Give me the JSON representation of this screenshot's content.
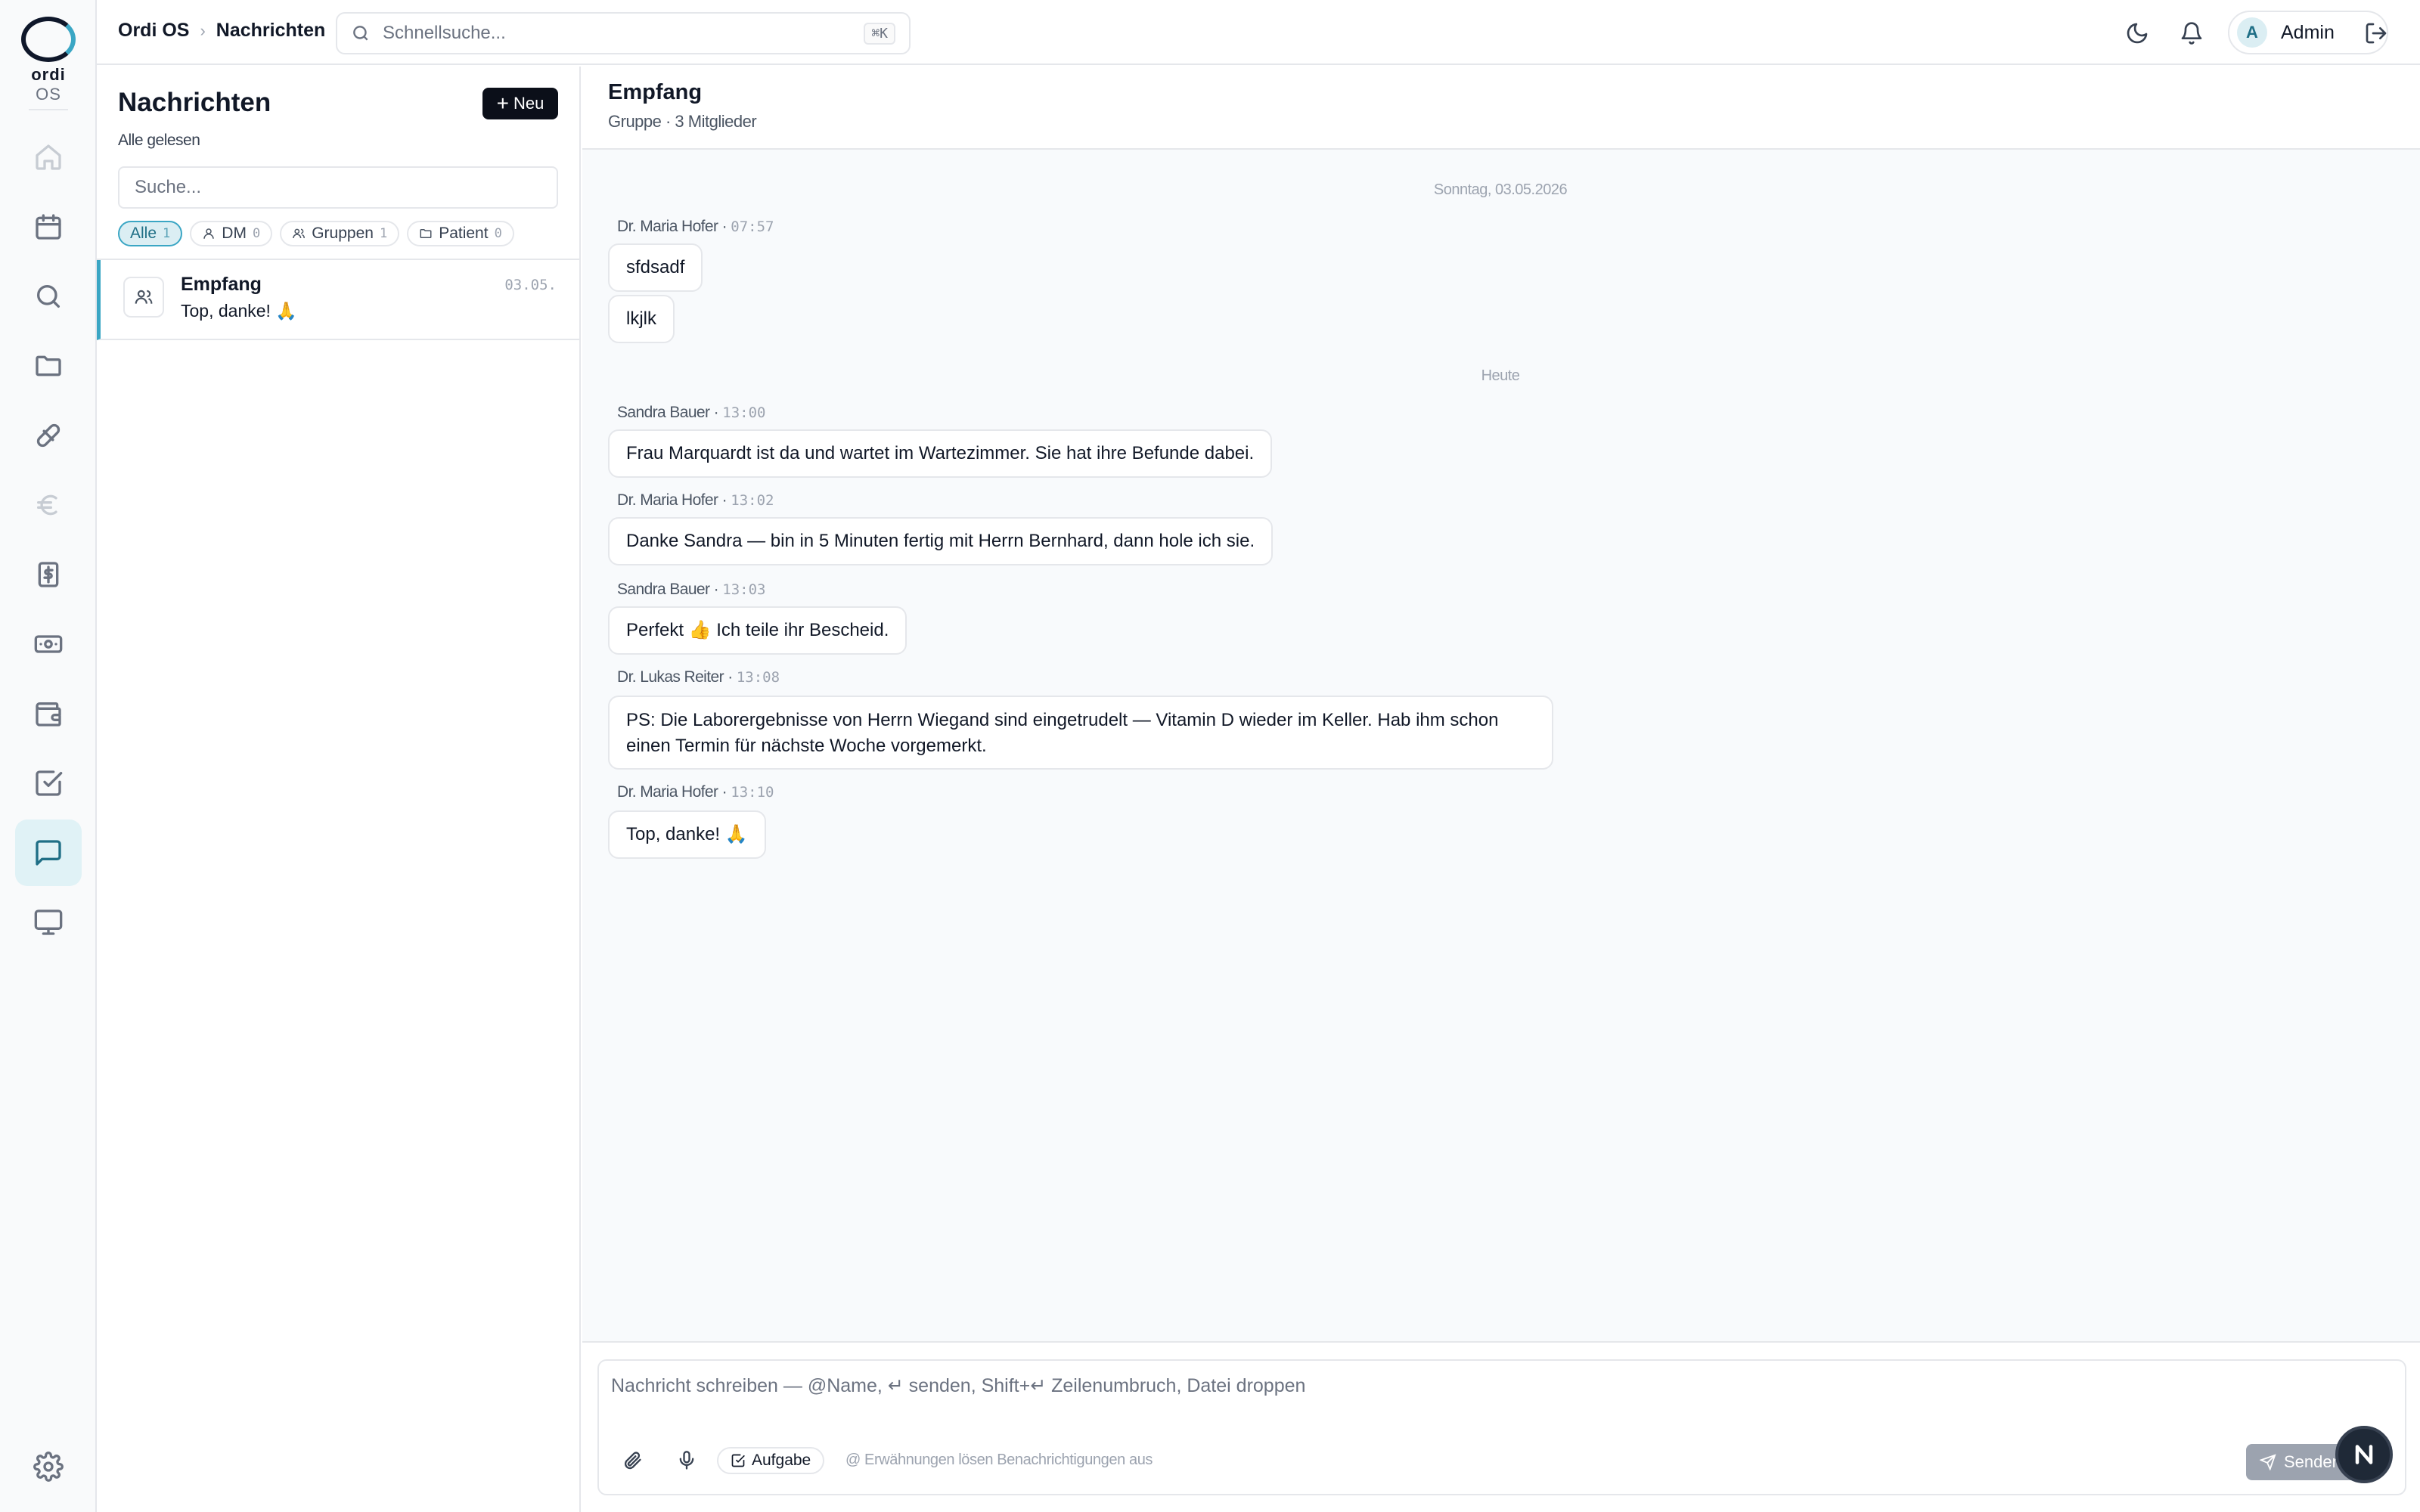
{
  "app": {
    "brand_primary": "ordi",
    "brand_secondary": "OS"
  },
  "breadcrumb": {
    "root": "Ordi OS",
    "current": "Nachrichten"
  },
  "search": {
    "placeholder": "Schnellsuche...",
    "shortcut": "⌘K"
  },
  "user": {
    "initial": "A",
    "name": "Admin"
  },
  "sidebar": {
    "items": [
      {
        "icon": "home-icon",
        "state": "disabled"
      },
      {
        "icon": "calendar-icon",
        "state": "normal"
      },
      {
        "icon": "search-icon",
        "state": "normal"
      },
      {
        "icon": "folder-icon",
        "state": "normal"
      },
      {
        "icon": "pill-icon",
        "state": "normal"
      },
      {
        "icon": "euro-icon",
        "state": "disabled"
      },
      {
        "icon": "dollar-receipt-icon",
        "state": "normal"
      },
      {
        "icon": "banknote-icon",
        "state": "normal"
      },
      {
        "icon": "wallet-icon",
        "state": "normal"
      },
      {
        "icon": "checkbox-icon",
        "state": "normal"
      },
      {
        "icon": "chat-icon",
        "state": "active"
      },
      {
        "icon": "monitor-icon",
        "state": "normal"
      },
      {
        "icon": "gear-icon",
        "state": "normal"
      }
    ]
  },
  "conversations": {
    "title": "Nachrichten",
    "new_label": "Neu",
    "mark_all_read": "Alle gelesen",
    "search_placeholder": "Suche...",
    "filters": [
      {
        "label": "Alle",
        "count": "1",
        "active": true
      },
      {
        "label": "DM",
        "count": "0",
        "icon": "user-icon"
      },
      {
        "label": "Gruppen",
        "count": "1",
        "icon": "users-icon"
      },
      {
        "label": "Patient",
        "count": "0",
        "icon": "folder-icon"
      }
    ],
    "items": [
      {
        "name": "Empfang",
        "preview": "Top, danke! 🙏",
        "date": "03.05.",
        "icon": "users-icon"
      }
    ]
  },
  "chat": {
    "title": "Empfang",
    "subtitle": "Gruppe · 3 Mitglieder",
    "day_separators": [
      "Sonntag, 03.05.2026",
      "Heute"
    ],
    "messages": [
      {
        "sender": "Dr. Maria Hofer",
        "time": "07:57",
        "texts": [
          "sfdsadf",
          "lkjlk"
        ]
      },
      {
        "sender": "Sandra Bauer",
        "time": "13:00",
        "texts": [
          "Frau Marquardt ist da und wartet im Wartezimmer. Sie hat ihre Befunde dabei."
        ]
      },
      {
        "sender": "Dr. Maria Hofer",
        "time": "13:02",
        "texts": [
          "Danke Sandra — bin in 5 Minuten fertig mit Herrn Bernhard, dann hole ich sie."
        ]
      },
      {
        "sender": "Sandra Bauer",
        "time": "13:03",
        "texts": [
          "Perfekt 👍 Ich teile ihr Bescheid."
        ]
      },
      {
        "sender": "Dr. Lukas Reiter",
        "time": "13:08",
        "texts": [
          "PS: Die Laborergebnisse von Herrn Wiegand sind eingetrudelt — Vitamin D wieder im Keller. Hab ihm schon einen Termin für nächste Woche vorgemerkt."
        ]
      },
      {
        "sender": "Dr. Maria Hofer",
        "time": "13:10",
        "texts": [
          "Top, danke! 🙏"
        ]
      }
    ]
  },
  "composer": {
    "placeholder": "Nachricht schreiben — @Name, ↵ senden, Shift+↵ Zeilenumbruch, Datei droppen",
    "task_label": "Aufgabe",
    "mention_hint": "@ Erwähnungen lösen Benachrichtigungen aus",
    "send_label": "Senden"
  },
  "colors": {
    "accent": "#3aa6c4",
    "accent_bg": "#dbeef3",
    "dark": "#0b0f19"
  }
}
